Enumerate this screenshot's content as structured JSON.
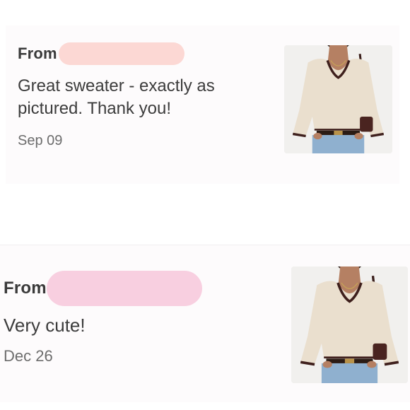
{
  "reviews": [
    {
      "from_label": "From",
      "message": "Great sweater - exactly as pictured. Thank you!",
      "date": "Sep 09",
      "thumbnail_icon": "sweater-product-photo"
    },
    {
      "from_label": "From",
      "message": "Very cute!",
      "date": "Dec 26",
      "thumbnail_icon": "sweater-product-photo"
    }
  ],
  "colors": {
    "background": "#ffffff",
    "card_background": "#fdfbfc",
    "redaction_1": "#fcd8d4",
    "redaction_2": "#f8cfe0",
    "text_primary": "#3c3c3c",
    "text_secondary": "#6d6d6d",
    "sweater": "#eadfce",
    "sweater_trim": "#3e1f1c",
    "denim": "#8fb0cf"
  }
}
